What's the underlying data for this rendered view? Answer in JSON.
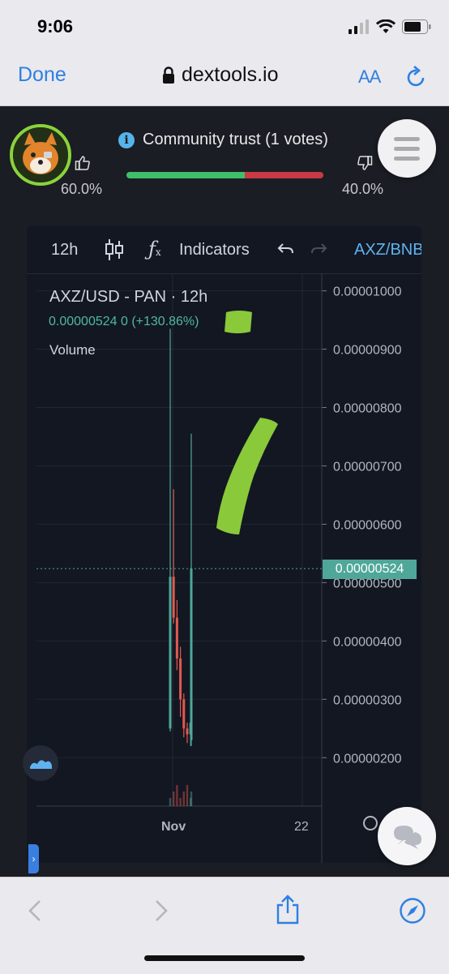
{
  "status_bar": {
    "time": "9:06"
  },
  "browser": {
    "done_label": "Done",
    "url": "dextools.io",
    "text_size_label": "AA"
  },
  "header": {
    "trust_title": "Community trust (1 votes)",
    "like_percent_text": "60.0%",
    "dislike_percent_text": "40.0%",
    "like_fraction": 0.6,
    "good_color": "#3fbf6a",
    "bad_color": "#c83a45"
  },
  "toolbar": {
    "interval": "12h",
    "indicators_label": "Indicators",
    "symbol": "AXZ/BNB"
  },
  "legend": {
    "title": "AXZ/USD - PAN · 12h",
    "values": "0.00000524  0 (+130.86%)",
    "volume_label": "Volume"
  },
  "chart_data": {
    "type": "candlestick",
    "title": "AXZ/USD - PAN · 12h",
    "price_axis_ticks": [
      "0.00001000",
      "0.00000900",
      "0.00000800",
      "0.00000700",
      "0.00000600",
      "0.00000500",
      "0.00000400",
      "0.00000300",
      "0.00000200"
    ],
    "time_axis_ticks": [
      "Nov",
      "22"
    ],
    "current_price": "0.00000524",
    "ylim": [
      1.17e-06,
      1.03e-05
    ],
    "candles": [
      {
        "open": 2.5e-06,
        "high": 9.35e-06,
        "low": 2.45e-06,
        "close": 5.1e-06,
        "dir": "up"
      },
      {
        "open": 5.1e-06,
        "high": 6.6e-06,
        "low": 4.3e-06,
        "close": 4.4e-06,
        "dir": "down"
      },
      {
        "open": 4.4e-06,
        "high": 4.7e-06,
        "low": 3.5e-06,
        "close": 3.7e-06,
        "dir": "down"
      },
      {
        "open": 3.7e-06,
        "high": 3.9e-06,
        "low": 2.7e-06,
        "close": 3e-06,
        "dir": "down"
      },
      {
        "open": 3e-06,
        "high": 3.1e-06,
        "low": 2.35e-06,
        "close": 2.5e-06,
        "dir": "down"
      },
      {
        "open": 2.5e-06,
        "high": 2.6e-06,
        "low": 2.25e-06,
        "close": 2.4e-06,
        "dir": "down"
      },
      {
        "open": 2.4e-06,
        "high": 4.3e-06,
        "low": 2.2e-06,
        "close": 2.6e-06,
        "dir": "up"
      },
      {
        "open": 2.3e-06,
        "high": 7.55e-06,
        "low": 2.2e-06,
        "close": 5.24e-06,
        "dir": "up"
      }
    ],
    "up_color": "#4fa79a",
    "down_color": "#e0594f",
    "grid": true
  }
}
